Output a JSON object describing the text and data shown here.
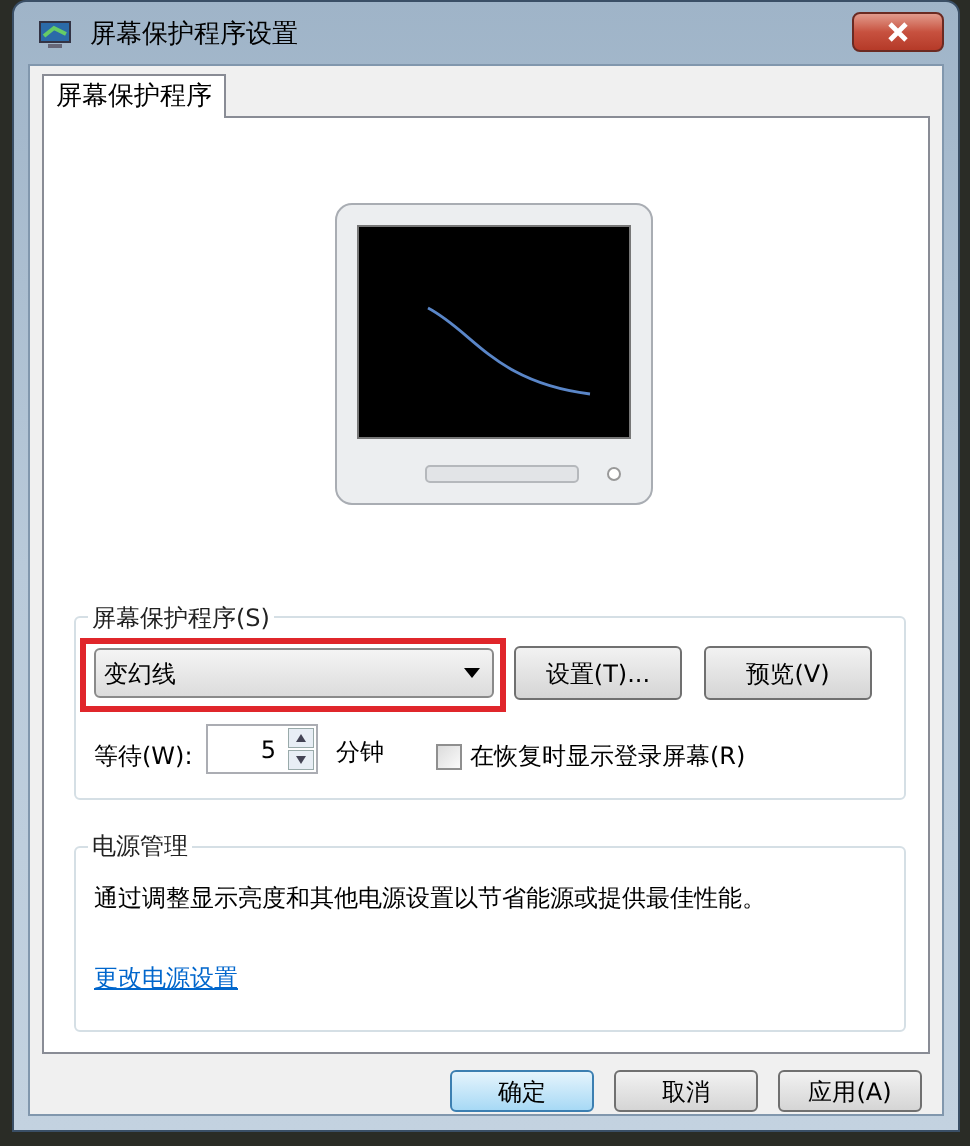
{
  "window": {
    "title": "屏幕保护程序设置"
  },
  "tabs": [
    {
      "label": "屏幕保护程序",
      "selected": true
    }
  ],
  "screen_saver": {
    "title": "屏幕保护程序(S)",
    "dropdown": {
      "value": "变幻线",
      "highlighted": true
    },
    "buttons": [
      "设置(T)...",
      "预览(V)"
    ],
    "wait_label": "等待(W):",
    "wait": "5",
    "wait_unit": "分钟",
    "resume_checkbox": {
      "label": "在恢复时显示登录屏幕(R)",
      "checked": false
    }
  },
  "power": {
    "title": "电源管理",
    "description": "通过调整显示亮度和其他电源设置以节省能源或提供最佳性能。",
    "link": "更改电源设置"
  },
  "buttons": [
    {
      "label": "确定",
      "default": true
    },
    {
      "label": "取消",
      "default": false
    },
    {
      "label": "应用(A)",
      "default": false
    }
  ]
}
